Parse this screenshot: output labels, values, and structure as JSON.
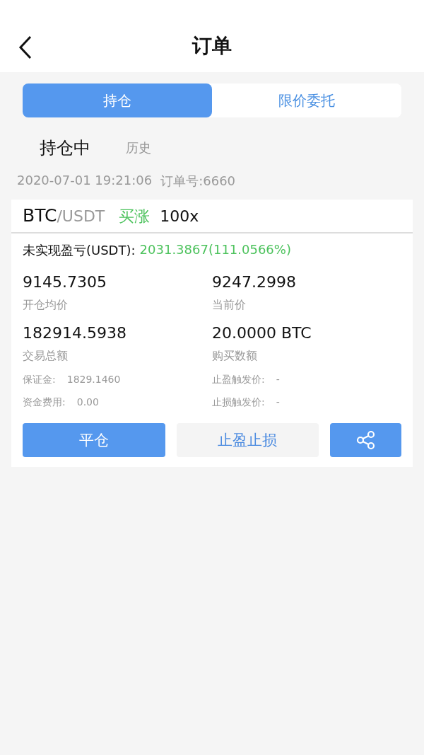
{
  "header": {
    "title": "订单"
  },
  "segments": [
    {
      "label": "持仓",
      "selected": true
    },
    {
      "label": "限价委托",
      "selected": false
    }
  ],
  "subtabs": [
    {
      "label": "持仓中",
      "selected": true
    },
    {
      "label": "历史",
      "selected": false
    }
  ],
  "order": {
    "time": "2020-07-01 19:21:06",
    "order_no": "订单号:6660",
    "base": "BTC",
    "quote": "/USDT",
    "side": "买涨",
    "leverage": "100x",
    "pnl_label": "未实现盈亏(USDT):",
    "pnl_value": "2031.3867(111.0566%)",
    "stats": [
      {
        "value": "9145.7305",
        "label": "开仓均价"
      },
      {
        "value": "9247.2998",
        "label": "当前价"
      },
      {
        "value": "182914.5938",
        "label": "交易总额"
      },
      {
        "value": "20.0000 BTC",
        "label": "购买数额"
      }
    ],
    "details": [
      {
        "label": "保证金:",
        "value": "1829.1460"
      },
      {
        "label": "止盈触发价:",
        "value": "-"
      },
      {
        "label": "资金费用:",
        "value": "0.00"
      },
      {
        "label": "止损触发价:",
        "value": "-"
      }
    ],
    "buttons": [
      {
        "kind": "primary",
        "label": "平仓"
      },
      {
        "kind": "secondary",
        "label": "止盈止损"
      },
      {
        "kind": "share"
      }
    ]
  }
}
